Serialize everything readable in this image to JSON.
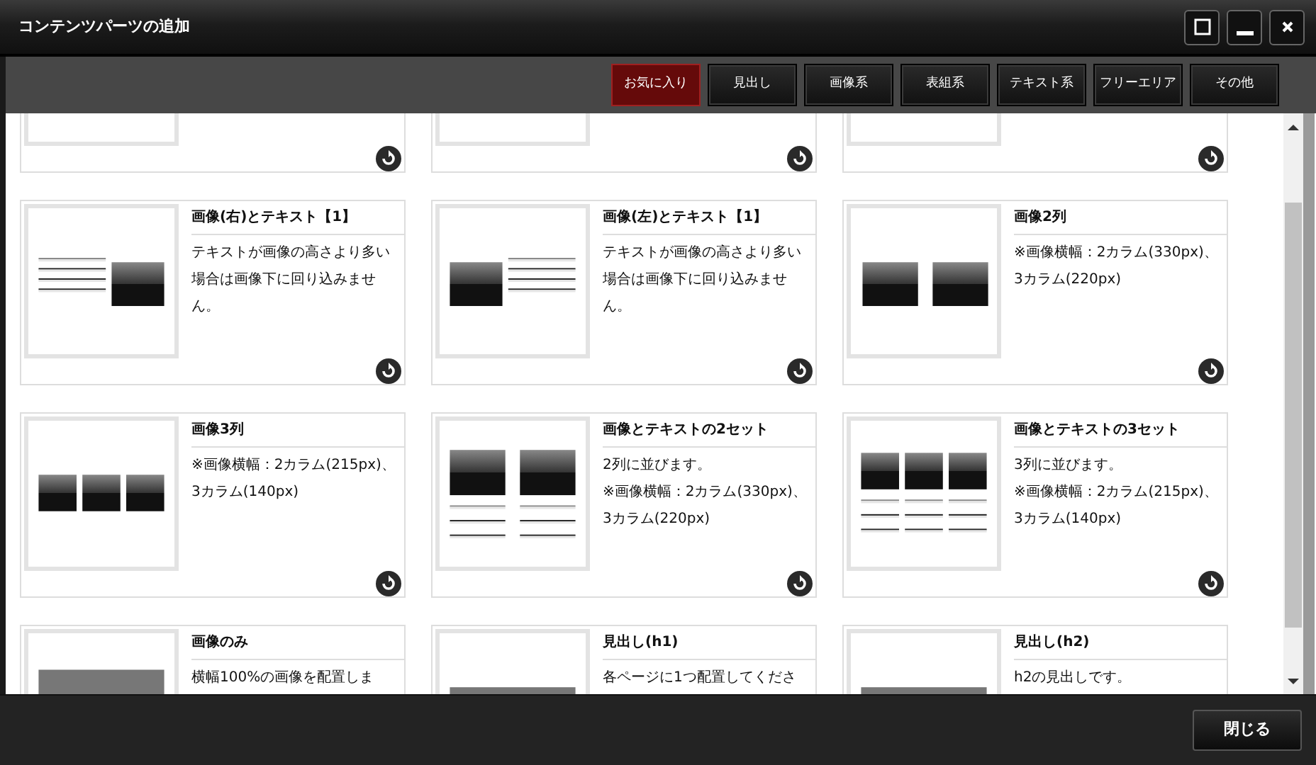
{
  "window": {
    "title": "コンテンツパーツの追加",
    "controls": [
      {
        "kind": "maximize"
      },
      {
        "kind": "minimize"
      },
      {
        "kind": "close"
      }
    ]
  },
  "tabs": [
    {
      "label": "お気に入り",
      "selected": true
    },
    {
      "label": "見出し",
      "selected": false
    },
    {
      "label": "画像系",
      "selected": false
    },
    {
      "label": "表組系",
      "selected": false
    },
    {
      "label": "テキスト系",
      "selected": false
    },
    {
      "label": "フリーエリア",
      "selected": false
    },
    {
      "label": "その他",
      "selected": false
    }
  ],
  "parts": [
    {
      "kind": "clipped"
    },
    {
      "kind": "clipped"
    },
    {
      "kind": "clipped"
    },
    {
      "kind": "text-image",
      "title": "画像(右)とテキスト【1】",
      "description": "テキストが画像の高さより多い場合は画像下に回り込みません。"
    },
    {
      "kind": "image-text",
      "title": "画像(左)とテキスト【1】",
      "description": "テキストが画像の高さより多い場合は画像下に回り込みません。"
    },
    {
      "kind": "images-2",
      "title": "画像2列",
      "description": "※画像横幅：2カラム(330px)、3カラム(220px)"
    },
    {
      "kind": "images-3",
      "title": "画像3列",
      "description": "※画像横幅：2カラム(215px)、3カラム(140px)"
    },
    {
      "kind": "sets-2",
      "title": "画像とテキストの2セット",
      "description": "2列に並びます。\n※画像横幅：2カラム(330px)、3カラム(220px)"
    },
    {
      "kind": "sets-3",
      "title": "画像とテキストの3セット",
      "description": "3列に並びます。\n※画像横幅：2カラム(215px)、3カラム(140px)"
    },
    {
      "kind": "image-only",
      "title": "画像のみ",
      "description": "横幅100%の画像を配置しま"
    },
    {
      "kind": "heading",
      "title": "見出し(h1)",
      "description": "各ページに1つ配置してくださ"
    },
    {
      "kind": "heading",
      "title": "見出し(h2)",
      "description": "h2の見出しです。"
    }
  ],
  "footer": {
    "close_button": "閉じる"
  }
}
